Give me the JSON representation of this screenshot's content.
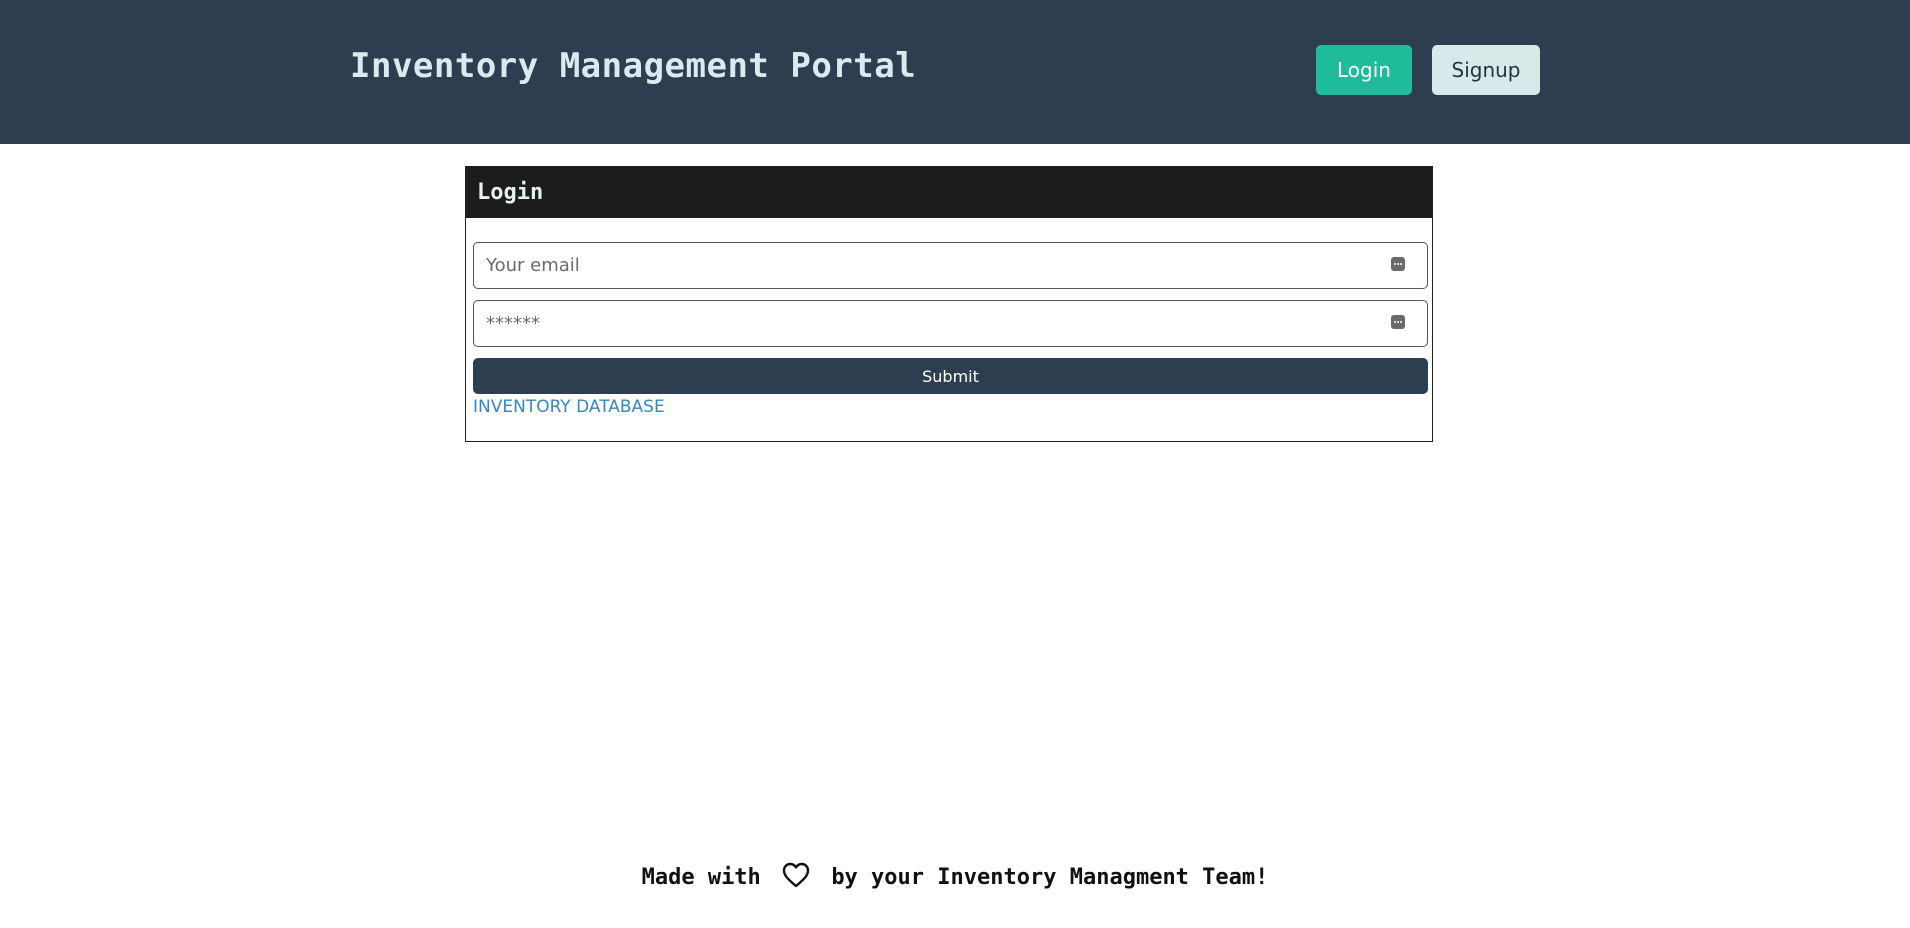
{
  "header": {
    "title": "Inventory Management Portal",
    "login_label": "Login",
    "signup_label": "Signup"
  },
  "login_card": {
    "title": "Login",
    "email_placeholder": "Your email",
    "password_placeholder": "******",
    "submit_label": "Submit",
    "link_text": "INVENTORY DATABASE"
  },
  "footer": {
    "text_before": "Made with",
    "icon": "heart-icon",
    "text_after": "by your Inventory Managment Team!"
  },
  "colors": {
    "header_bg": "#2e3e51",
    "login_button": "#1fbc9c",
    "signup_button": "#d9e9e9",
    "link": "#3587bd"
  }
}
